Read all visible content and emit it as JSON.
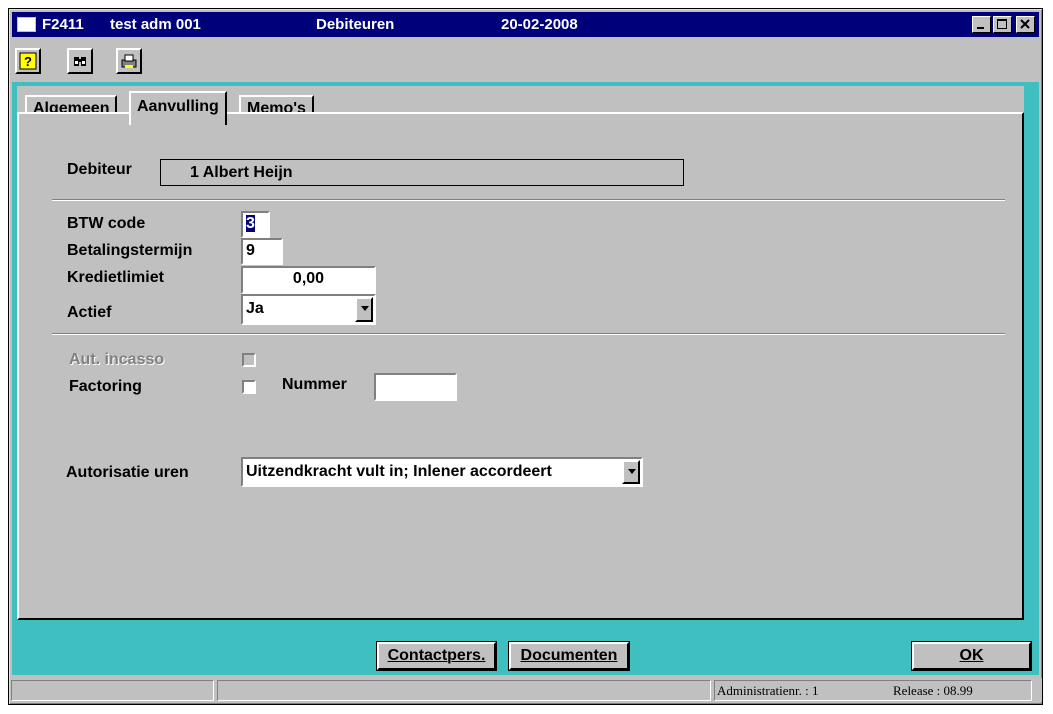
{
  "titlebar": {
    "code": "F2411",
    "admin": "test adm 001",
    "title": "Debiteuren",
    "date": "20-02-2008"
  },
  "toolbar": {
    "icons": [
      "help-icon",
      "search-icon",
      "print-icon"
    ]
  },
  "tabs": [
    {
      "label": "Algemeen"
    },
    {
      "label": "Aanvulling",
      "active": true
    },
    {
      "label": "Memo's"
    }
  ],
  "form": {
    "debiteur_label": "Debiteur",
    "debiteur_value": "1 Albert Heijn",
    "btw_label": "BTW code",
    "btw_value": "3",
    "betaling_label": "Betalingstermijn",
    "betaling_value": "9",
    "krediet_label": "Kredietlimiet",
    "krediet_value": "0,00",
    "actief_label": "Actief",
    "actief_value": "Ja",
    "incasso_label": "Aut. incasso",
    "factoring_label": "Factoring",
    "nummer_label": "Nummer",
    "nummer_value": "",
    "autorisatie_label": "Autorisatie uren",
    "autorisatie_value": "Uitzendkracht vult in; Inlener accordeert"
  },
  "buttons": {
    "contact": "Contactpers.",
    "documenten": "Documenten",
    "ok": "OK"
  },
  "statusbar": {
    "admin": "Administratienr. :  1",
    "release": "Release : 08.99"
  }
}
